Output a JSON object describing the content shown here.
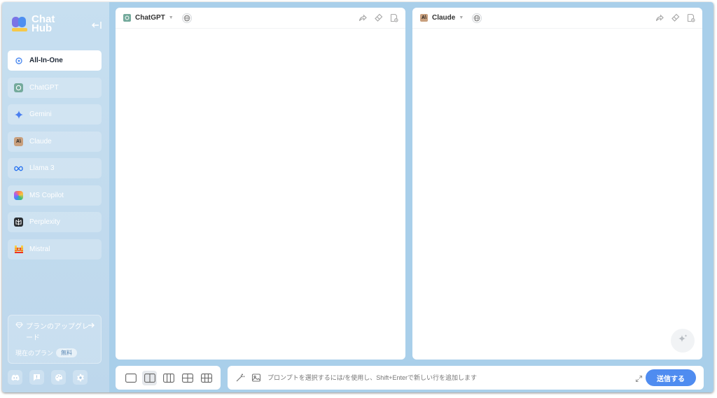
{
  "app": {
    "logo_line1": "Chat",
    "logo_line2": "Hub"
  },
  "sidebar": {
    "items": [
      {
        "label": "All-In-One",
        "icon": "gear-icon",
        "active": true
      },
      {
        "label": "ChatGPT",
        "icon": "chatgpt-icon"
      },
      {
        "label": "Gemini",
        "icon": "gemini-sparkle-icon"
      },
      {
        "label": "Claude",
        "icon": "claude-icon"
      },
      {
        "label": "Llama 3",
        "icon": "meta-infinity-icon"
      },
      {
        "label": "MS Copilot",
        "icon": "copilot-icon"
      },
      {
        "label": "Perplexity",
        "icon": "perplexity-icon"
      },
      {
        "label": "Mistral",
        "icon": "mistral-icon"
      }
    ],
    "upgrade": {
      "title": "プランのアップグレード",
      "current_plan_label": "現在のプラン",
      "plan_badge": "無料"
    },
    "bottom_icons": [
      "discord-icon",
      "feedback-icon",
      "theme-palette-icon",
      "settings-icon"
    ]
  },
  "panels": {
    "left": {
      "bot_name": "ChatGPT"
    },
    "right": {
      "bot_name": "Claude"
    }
  },
  "input": {
    "placeholder": "プロンプトを選択するには/を使用し、Shift+Enterで新しい行を追加します",
    "send_label": "送信する"
  },
  "colors": {
    "sidebar_bg": "#c7dff0",
    "main_bg": "#a9cfea",
    "accent": "#4f8cf0",
    "chatgpt": "#74aa9c",
    "claude": "#c9a07e"
  }
}
